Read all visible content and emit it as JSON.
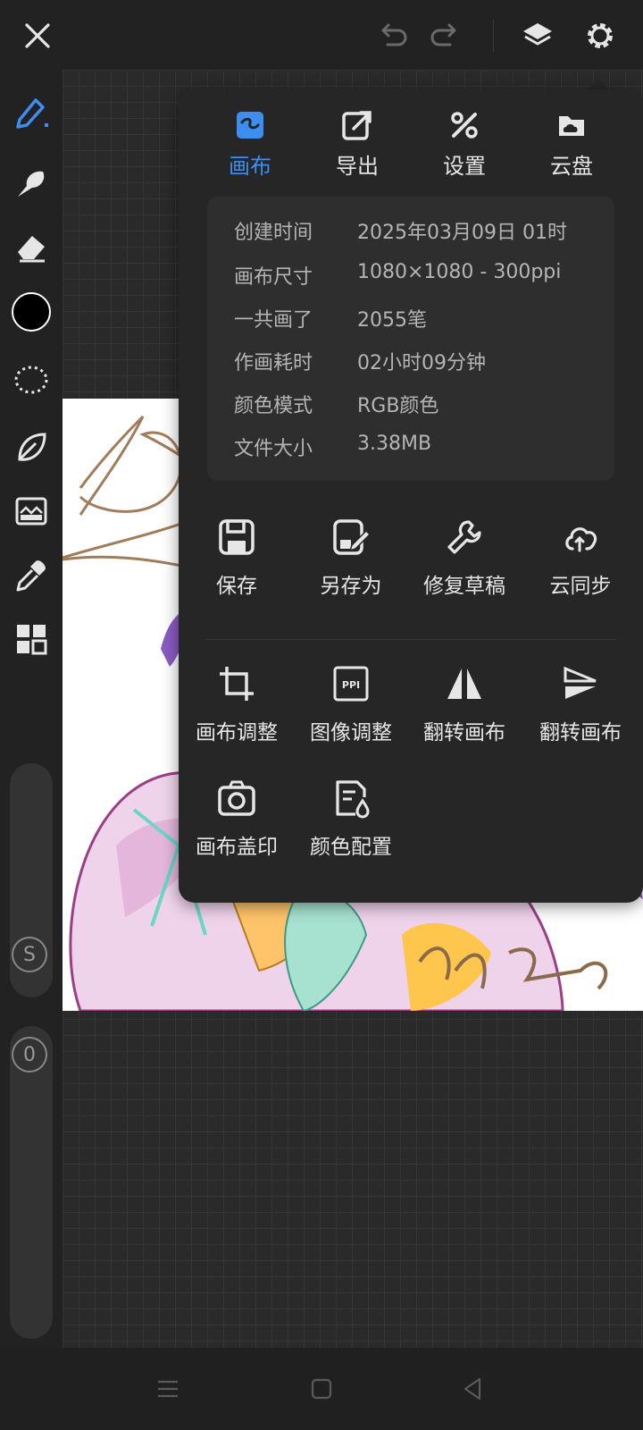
{
  "app": {
    "colors": {
      "accent": "#3d8ef0",
      "background": "#1f1f1f",
      "panel": "#262626",
      "text": "#e6e6e6"
    }
  },
  "topbar": {
    "close_icon": "close-icon",
    "undo_icon": "undo-icon",
    "redo_icon": "redo-icon",
    "layers_icon": "layers-icon",
    "settings_icon": "gear-icon"
  },
  "toolbar": {
    "tools": [
      "brush",
      "smudge",
      "eraser",
      "color",
      "lasso",
      "leaf",
      "filter",
      "eyedropper",
      "grid"
    ],
    "current_color": "#000000",
    "size_label": "S",
    "opacity_label": "0"
  },
  "menu": {
    "tabs": [
      {
        "label": "画布",
        "icon": "canvas-icon",
        "active": true
      },
      {
        "label": "导出",
        "icon": "export-icon",
        "active": false
      },
      {
        "label": "设置",
        "icon": "settings-tools-icon",
        "active": false
      },
      {
        "label": "云盘",
        "icon": "cloud-drive-icon",
        "active": false
      }
    ],
    "info": [
      {
        "key": "创建时间",
        "value": "2025年03月09日 01时"
      },
      {
        "key": "画布尺寸",
        "value": "1080×1080 - 300ppi"
      },
      {
        "key": "一共画了",
        "value": "2055笔"
      },
      {
        "key": "作画耗时",
        "value": "02小时09分钟"
      },
      {
        "key": "颜色模式",
        "value": "RGB颜色"
      },
      {
        "key": "文件大小",
        "value": "3.38MB"
      }
    ],
    "actions": [
      {
        "label": "保存",
        "icon": "save-icon"
      },
      {
        "label": "另存为",
        "icon": "save-as-icon"
      },
      {
        "label": "修复草稿",
        "icon": "wrench-icon"
      },
      {
        "label": "云同步",
        "icon": "cloud-sync-icon"
      },
      {
        "label": "画布调整",
        "icon": "crop-icon"
      },
      {
        "label": "图像调整",
        "icon": "ppi-icon"
      },
      {
        "label": "翻转画布",
        "icon": "flip-horizontal-icon"
      },
      {
        "label": "翻转画布",
        "icon": "flip-vertical-icon"
      },
      {
        "label": "画布盖印",
        "icon": "camera-icon"
      },
      {
        "label": "颜色配置",
        "icon": "color-profile-icon"
      }
    ]
  },
  "navbar": {
    "menu_icon": "menu-icon",
    "home_icon": "home-icon",
    "back_icon": "back-icon"
  }
}
